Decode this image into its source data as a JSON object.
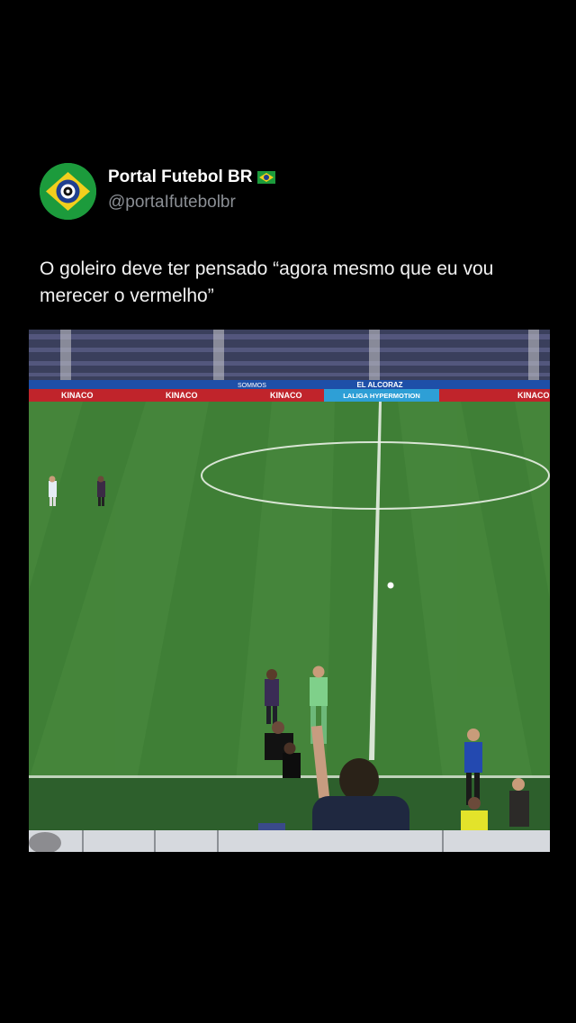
{
  "tweet": {
    "author": {
      "display_name": "Portal Futebol BR",
      "badge_icon": "brazil-flag-icon",
      "handle": "@portaIfutebolbr",
      "avatar_icon": "brazil-flag-avatar"
    },
    "text": "O goleiro deve ter pensado “agora mesmo que eu vou merecer o vermelho”"
  },
  "media": {
    "type": "video-frame",
    "boards": {
      "sponsor_1": "KINACO",
      "sponsor_2": "SOMMOS",
      "stadium": "EL ALCORAZ",
      "league": "LALIGA HYPERMOTION"
    }
  },
  "colors": {
    "background": "#000000",
    "handle": "#8b8f95",
    "pitch": "#3f7f36",
    "board_blue": "#1e4fa8",
    "board_red": "#c0242b"
  }
}
